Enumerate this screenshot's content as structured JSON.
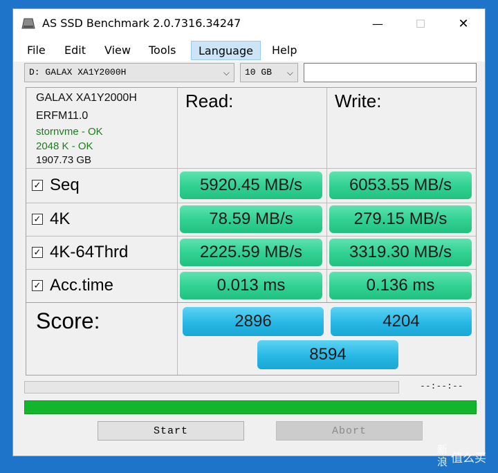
{
  "window": {
    "title": "AS SSD Benchmark 2.0.7316.34247",
    "minimize_glyph": "—",
    "maximize_glyph": "☐",
    "close_glyph": "✕"
  },
  "menu": {
    "items": [
      "File",
      "Edit",
      "View",
      "Tools",
      "Language",
      "Help"
    ],
    "active": "Language"
  },
  "toolbar": {
    "drive_select": "D: GALAX XA1Y2000H",
    "size_select": "10 GB",
    "dropdown_glyph": "⌵",
    "free_text": ""
  },
  "drive_info": {
    "model": "GALAX XA1Y2000H",
    "firmware": "ERFM11.0",
    "driver_status": "stornvme - OK",
    "alignment_status": "2048 K - OK",
    "capacity": "1907.73 GB"
  },
  "headers": {
    "read": "Read:",
    "write": "Write:"
  },
  "check_glyph": "✓",
  "rows": [
    {
      "label": "Seq",
      "checked": true,
      "read": "5920.45 MB/s",
      "write": "6053.55 MB/s"
    },
    {
      "label": "4K",
      "checked": true,
      "read": "78.59 MB/s",
      "write": "279.15 MB/s"
    },
    {
      "label": "4K-64Thrd",
      "checked": true,
      "read": "2225.59 MB/s",
      "write": "3319.30 MB/s"
    },
    {
      "label": "Acc.time",
      "checked": true,
      "read": "0.013 ms",
      "write": "0.136 ms"
    }
  ],
  "score": {
    "label": "Score:",
    "read": "2896",
    "write": "4204",
    "total": "8594"
  },
  "progress": {
    "time_text": "--:--:--",
    "test_progress": 0,
    "overall_progress": 1
  },
  "buttons": {
    "start": "Start",
    "abort": "Abort"
  },
  "colors": {
    "result_green": "#2fd090",
    "score_blue": "#27b7e4",
    "progress_green": "#12b52c",
    "driver_ok_green": "#1e7b1e"
  },
  "watermark": {
    "chars": [
      "新",
      "浪"
    ],
    "brand": "值么买"
  }
}
